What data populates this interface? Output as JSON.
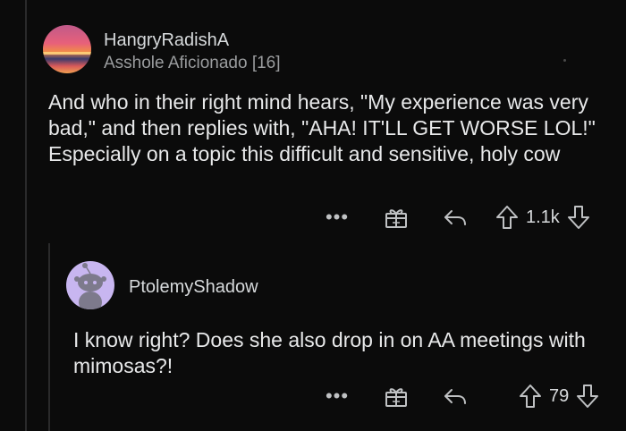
{
  "comments": [
    {
      "username": "HangryRadishA",
      "flair": "Asshole Aficionado [16]",
      "body": "And who in their right mind hears, \"My experience was very bad,\" and then replies with, \"AHA! IT'LL GET WORSE LOL!\" Especially on a topic this difficult and sensitive, holy cow",
      "more_label": "•••",
      "score": "1.1k"
    },
    {
      "username": "PtolemyShadow",
      "flair": "",
      "body": "I know right? Does she also drop in on AA meetings with mimosas?!",
      "more_label": "•••",
      "score": "79"
    }
  ],
  "icons": {
    "more": "more-options-icon",
    "award": "award-gift-icon",
    "reply": "reply-arrow-icon",
    "upvote": "upvote-arrow-icon",
    "downvote": "downvote-arrow-icon"
  },
  "colors": {
    "background": "#0b0b0b",
    "text": "#e8e9ea",
    "muted": "#9a9c9e",
    "icon": "#bfc1c3",
    "avatar2_bg": "#c8b6f0"
  }
}
